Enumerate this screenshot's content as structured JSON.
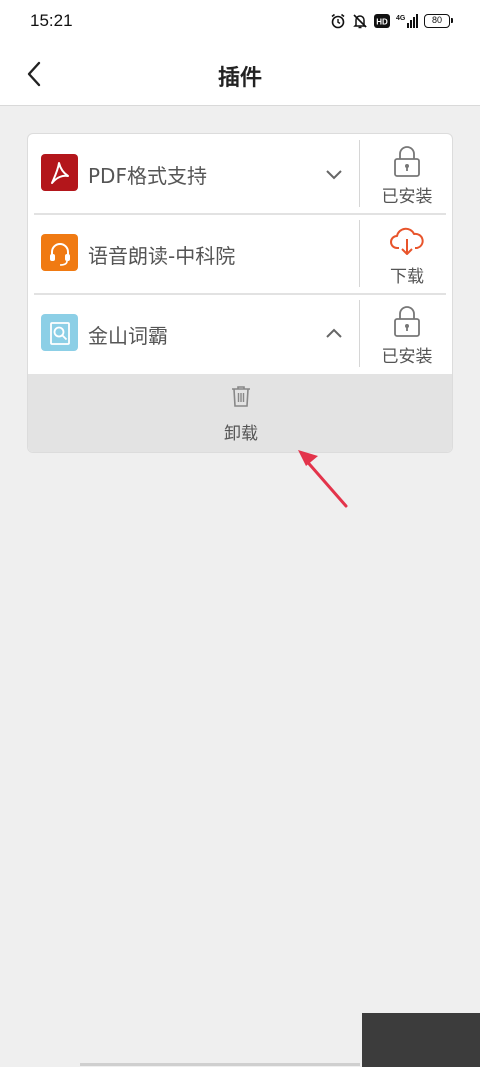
{
  "status_bar": {
    "time": "15:21",
    "network": "4G",
    "battery_level": "80",
    "icons": [
      "alarm-icon",
      "mute-bell-icon",
      "hd-icon",
      "signal-icon",
      "battery-icon"
    ]
  },
  "nav": {
    "title": "插件",
    "back_icon": "chevron-left-icon"
  },
  "plugins": [
    {
      "name": "PDF格式支持",
      "icon": "pdf-icon",
      "expand_icon": "chevron-down-icon",
      "status": "已安装",
      "status_icon": "lock-icon"
    },
    {
      "name": "语音朗读-中科院",
      "icon": "headset-icon",
      "status": "下载",
      "status_icon": "cloud-download-icon"
    },
    {
      "name": "金山词霸",
      "icon": "dictionary-icon",
      "expand_icon": "chevron-up-icon",
      "status": "已安装",
      "status_icon": "lock-icon"
    }
  ],
  "uninstall": {
    "label": "卸载",
    "icon": "trash-icon"
  },
  "colors": {
    "accent": "#e8542b",
    "pdf_red": "#b3161b",
    "headset_orange": "#f07a12",
    "dictionary_blue": "#8ccfe6",
    "annotation_arrow": "#e3344b"
  }
}
